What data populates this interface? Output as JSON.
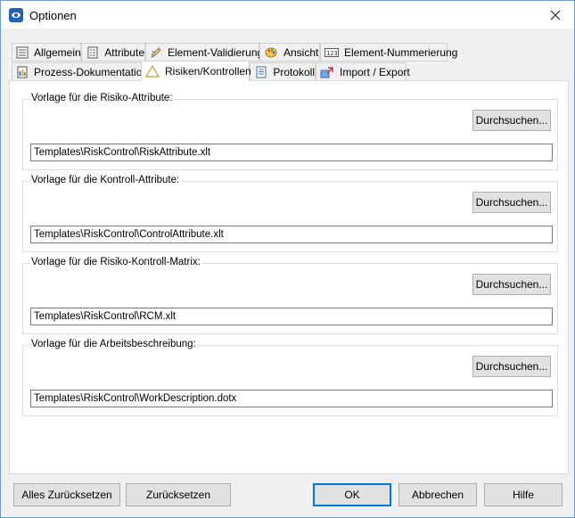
{
  "window": {
    "title": "Optionen"
  },
  "tabs": {
    "row1": [
      {
        "label": "Allgemein",
        "icon": "list-icon"
      },
      {
        "label": "Attribute",
        "icon": "attribute-list-icon"
      },
      {
        "label": "Element-Validierung",
        "icon": "validation-pen-icon"
      },
      {
        "label": "Ansicht",
        "icon": "palette-icon"
      },
      {
        "label": "Element-Nummerierung",
        "icon": "numbering-icon"
      }
    ],
    "row2": [
      {
        "label": "Prozess-Dokumentation",
        "icon": "document-icon"
      },
      {
        "label": "Risiken/Kontrollen",
        "icon": "warning-triangle-icon",
        "active": true
      },
      {
        "label": "Protokoll",
        "icon": "log-icon"
      },
      {
        "label": "Import / Export",
        "icon": "import-export-icon"
      }
    ]
  },
  "groups": [
    {
      "title": "Vorlage für die Risiko-Attribute:",
      "button": "Durchsuchen...",
      "path": "Templates\\RiskControl\\RiskAttribute.xlt"
    },
    {
      "title": "Vorlage für die Kontroll-Attribute:",
      "button": "Durchsuchen...",
      "path": "Templates\\RiskControl\\ControlAttribute.xlt"
    },
    {
      "title": "Vorlage für die Risiko-Kontroll-Matrix:",
      "button": "Durchsuchen...",
      "path": "Templates\\RiskControl\\RCM.xlt"
    },
    {
      "title": "Vorlage für die Arbeitsbeschreibung:",
      "button": "Durchsuchen...",
      "path": "Templates\\RiskControl\\WorkDescription.dotx"
    }
  ],
  "footer": {
    "reset_all": "Alles Zurücksetzen",
    "reset": "Zurücksetzen",
    "ok": "OK",
    "cancel": "Abbrechen",
    "help": "Hilfe"
  },
  "colors": {
    "accent": "#0078d7",
    "window_bg": "#f0f0f0",
    "panel_bg": "#ffffff"
  }
}
